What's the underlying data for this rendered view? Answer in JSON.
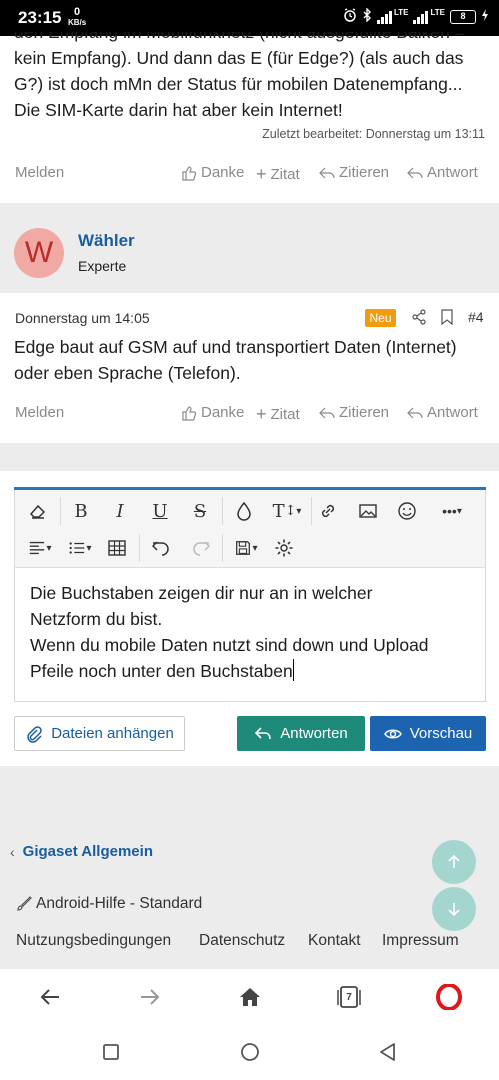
{
  "status_bar": {
    "time": "23:15",
    "net_speed_value": "0",
    "net_speed_unit": "KB/s",
    "lte1": "LTE",
    "lte2": "LTE",
    "battery": "8"
  },
  "previous_post": {
    "text_lines": [
      "den Empfang im Mobilfunknetz (nicht ausgefüllte Balken =",
      "kein Empfang). Und dann das E (für Edge?) (als auch das",
      "G?) ist doch mMn der Status für mobilen Datenempfang...",
      "Die SIM-Karte darin hat aber kein Internet!"
    ],
    "edited": "Zuletzt bearbeitet: Donnerstag um 13:11"
  },
  "actions1": {
    "report": "Melden",
    "thanks": "Danke",
    "quote_plus": "Zitat",
    "quote": "Zitieren",
    "reply": "Antwort"
  },
  "author": {
    "initial": "W",
    "name": "Wähler",
    "title": "Experte",
    "avatar_bg": "#f1a9a4",
    "avatar_fg": "#b92d2d"
  },
  "post": {
    "date": "Donnerstag um 14:05",
    "badge": "Neu",
    "number": "#4",
    "text_lines": [
      "Edge baut auf GSM auf und transportiert Daten (Internet)",
      "oder eben Sprache (Telefon)."
    ]
  },
  "actions2": {
    "report": "Melden",
    "thanks": "Danke",
    "quote_plus": "Zitat",
    "quote": "Zitieren",
    "reply": "Antwort"
  },
  "editor": {
    "content_lines": [
      "Die Buchstaben zeigen dir nur an in welcher",
      "Netzform du bist.",
      "Wenn du mobile Daten nutzt sind down und Upload",
      "Pfeile noch unter den Buchstaben"
    ],
    "toolbar_icons": [
      "eraser-icon",
      "bold-icon",
      "italic-icon",
      "underline-icon",
      "strikethrough-icon",
      "color-icon",
      "font-size-icon",
      "link-icon",
      "image-icon",
      "smiley-icon",
      "more-icon",
      "align-icon",
      "list-icon",
      "table-icon",
      "undo-icon",
      "redo-icon",
      "drafts-icon",
      "settings-icon"
    ]
  },
  "buttons": {
    "attach": "Dateien anhängen",
    "reply": "Antworten",
    "preview": "Vorschau"
  },
  "footer": {
    "forum_link": "Gigaset Allgemein",
    "style": "Android-Hilfe - Standard",
    "links": [
      "Nutzungsbedingungen",
      "Datenschutz",
      "Kontakt",
      "Impressum"
    ]
  },
  "browser": {
    "tab_count": "7"
  },
  "colors": {
    "link_blue": "#185e9e",
    "reply_green": "#1e8a7a",
    "preview_blue": "#1c63b0",
    "badge_orange": "#f29b10",
    "fab_teal": "#a4d6cf",
    "opera_red": "#e0161b"
  }
}
